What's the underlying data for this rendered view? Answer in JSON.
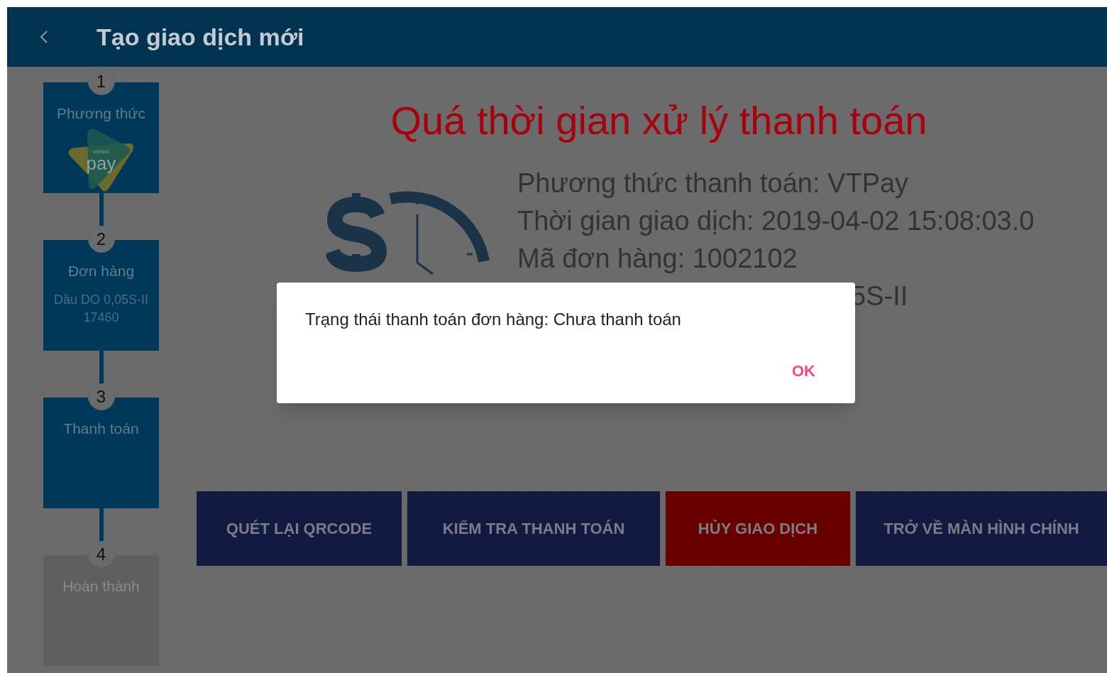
{
  "header": {
    "title": "Tạo giao dịch mới"
  },
  "steps": [
    {
      "number": "1",
      "label": "Phương thức",
      "disabled": false,
      "logo": {
        "brand": "viettel",
        "product": "pay"
      }
    },
    {
      "number": "2",
      "label": "Đơn hàng",
      "disabled": false,
      "detail": "Dầu DO 0,05S-II\n17460"
    },
    {
      "number": "3",
      "label": "Thanh toán",
      "disabled": false
    },
    {
      "number": "4",
      "label": "Hoàn thành",
      "disabled": true
    }
  ],
  "result": {
    "title": "Quá thời gian xử lý thanh toán",
    "info": [
      {
        "kind": "full",
        "text": "Phương thức thanh toán: VTPay"
      },
      {
        "kind": "full",
        "text": "Thời gian giao dịch: 2019-04-02 15:08:03.0"
      },
      {
        "kind": "full",
        "text": "Mã đơn hàng: 1002102"
      },
      {
        "kind": "partial",
        "text": "5S-II"
      }
    ]
  },
  "actions": [
    {
      "label": "QUÉT LẠI QRCODE",
      "kind": "primary"
    },
    {
      "label": "KIỂM TRA THANH TOÁN",
      "kind": "primary"
    },
    {
      "label": "HỦY GIAO DỊCH",
      "kind": "danger"
    },
    {
      "label": "TRỞ VỀ MÀN HÌNH CHÍNH",
      "kind": "primary"
    }
  ],
  "dialog": {
    "message": "Trạng thái thanh toán đơn hàng: Chưa thanh toán",
    "button": "OK"
  }
}
